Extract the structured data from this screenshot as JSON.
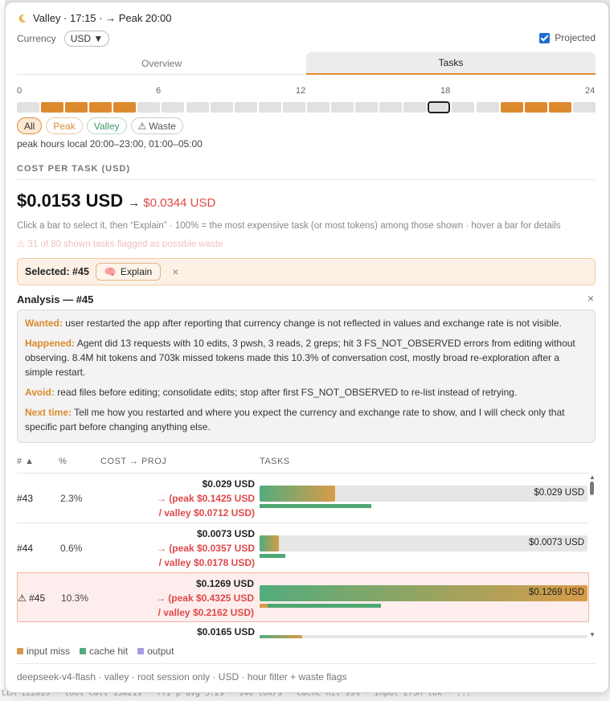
{
  "background": {
    "letters": [
      "D",
      "di",
      "ei",
      "ei",
      "I",
      "y",
      "C",
      "ei",
      "di",
      "D",
      "0"
    ],
    "status_line": "LLM 122m19 · tool call 15m21s · TTI p avg 3.2s · 140 tok/s · Cache hit 99% · Input 273M tok · ..."
  },
  "header": {
    "moon_icon": "crescent-moon-icon",
    "title": "Valley · 17:15 · → Peak 20:00"
  },
  "currency": {
    "label": "Currency",
    "value": "USD ▼"
  },
  "projected": {
    "label": "Projected",
    "checked": true
  },
  "tabs": [
    {
      "label": "Overview",
      "active": false
    },
    {
      "label": "Tasks",
      "active": true
    }
  ],
  "hour_axis": [
    "0",
    "6",
    "12",
    "18",
    "24"
  ],
  "hour_bars": {
    "peak_hours": [
      1,
      2,
      3,
      4,
      20,
      21,
      22
    ],
    "current_hour": 17
  },
  "filters": [
    {
      "label": "All",
      "style": "all"
    },
    {
      "label": "Peak",
      "style": "peak"
    },
    {
      "label": "Valley",
      "style": "valley"
    },
    {
      "label": "Waste",
      "style": "waste",
      "icon": "warning-icon"
    }
  ],
  "peak_hours_text": "peak hours local 20:00–23:00, 01:00–05:00",
  "cost_section": {
    "title": "COST PER TASK (USD)",
    "value": "$0.0153 USD",
    "arrow": "→",
    "projected": "$0.0344 USD",
    "hint": "Click a bar to select it, then “Explain” · 100% = the most expensive task (or most tokens) among those shown · hover a bar for details",
    "flag": "⚠ 31 of 80 shown tasks flagged as possible waste"
  },
  "selected": {
    "label": "Selected: #45",
    "explain_icon": "brain-icon",
    "explain_label": "Explain",
    "close": "×"
  },
  "analysis": {
    "title": "Analysis — #45",
    "close": "×",
    "wanted_key": "Wanted:",
    "wanted": "user restarted the app after reporting that currency change is not reflected in values and exchange rate is not visible.",
    "happened_key": "Happened:",
    "happened": "Agent did 13 requests with 10 edits, 3 pwsh, 3 reads, 2 greps; hit 3 FS_NOT_OBSERVED errors from editing without observing. 8.4M hit tokens and 703k missed tokens made this 10.3% of conversation cost, mostly broad re-exploration after a simple restart.",
    "avoid_key": "Avoid:",
    "avoid": "read files before editing; consolidate edits; stop after first FS_NOT_OBSERVED to re-list instead of retrying.",
    "next_key": "Next time:",
    "next": "Tell me how you restarted and where you expect the currency and exchange rate to show, and I will check only that specific part before changing anything else."
  },
  "table": {
    "col_num": "# ▲",
    "col_pct": "%",
    "col_cost": "COST → PROJ",
    "col_tasks": "TASKS",
    "rows": [
      {
        "num": "#43",
        "pct": "2.3%",
        "cost": "$0.029 USD",
        "proj1": "→ (peak $0.1425 USD",
        "proj2": "/ valley $0.0712 USD)",
        "bar_label": "$0.029 USD",
        "fill": 0.23,
        "cache": 0.34,
        "miss": 0,
        "selected": false
      },
      {
        "num": "#44",
        "pct": "0.6%",
        "cost": "$0.0073 USD",
        "proj1": "→ (peak $0.0357 USD",
        "proj2": "/ valley $0.0178 USD)",
        "bar_label": "$0.0073 USD",
        "fill": 0.058,
        "cache": 0.078,
        "miss": 0,
        "selected": false
      },
      {
        "num": "⚠ #45",
        "pct": "10.3%",
        "cost": "$0.1269 USD",
        "proj1": "→ (peak $0.4325 USD",
        "proj2": "/ valley $0.2162 USD)",
        "bar_label": "$0.1269 USD",
        "fill": 1.0,
        "cache": 0.345,
        "miss": 0.025,
        "selected": true
      },
      {
        "num": "",
        "pct": "",
        "cost": "$0.0165 USD",
        "proj1": "",
        "proj2": "",
        "bar_label": "",
        "fill": 0.13,
        "cache": 0,
        "miss": 0,
        "selected": false
      }
    ]
  },
  "legend": [
    {
      "label": "input miss",
      "color": "#d89c48"
    },
    {
      "label": "cache hit",
      "color": "#52ac7c"
    },
    {
      "label": "output",
      "color": "#a99be0"
    }
  ],
  "footer": "deepseek-v4-flash · valley · root session only · USD · hour filter + waste flags"
}
